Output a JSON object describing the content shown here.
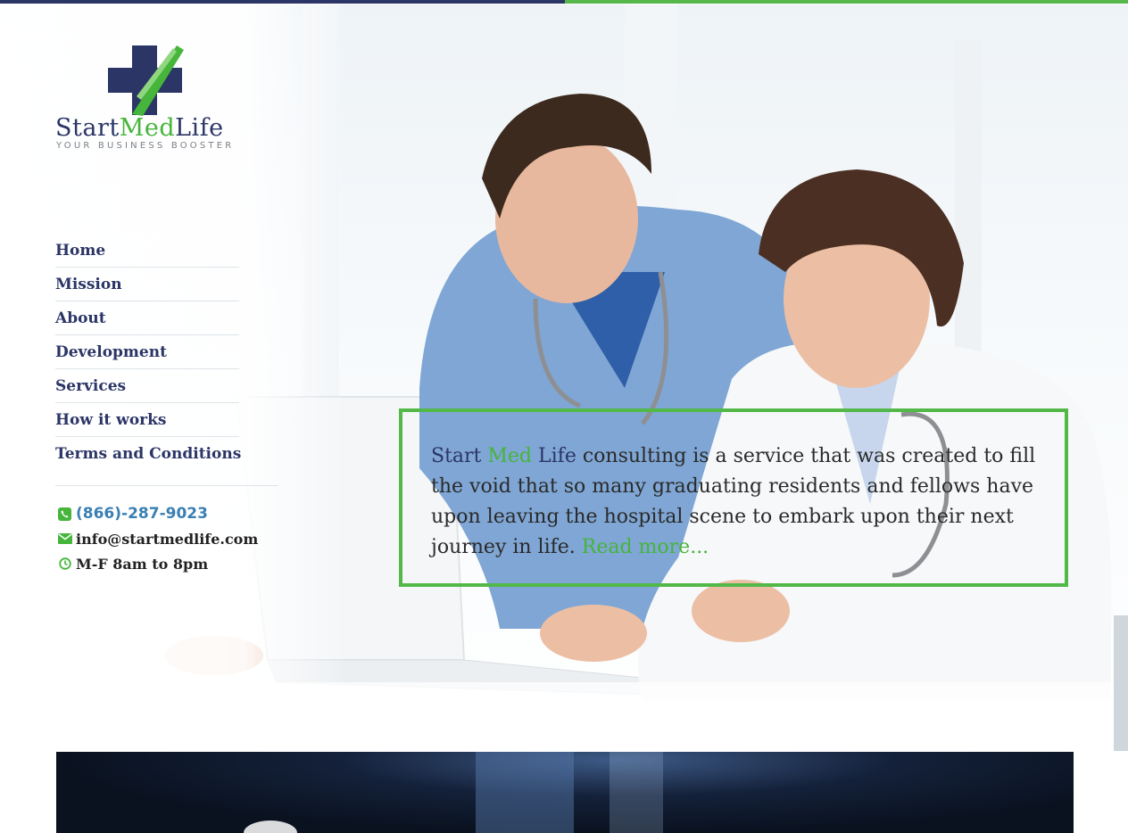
{
  "brand": {
    "name_start": "Start",
    "name_med": "Med",
    "name_life": "Life",
    "tagline": "YOUR BUSINESS BOOSTER",
    "colors": {
      "navy": "#2b3566",
      "green": "#46b53b",
      "phone_blue": "#3a7fb3"
    }
  },
  "nav": {
    "items": [
      {
        "label": "Home"
      },
      {
        "label": "Mission"
      },
      {
        "label": "About"
      },
      {
        "label": "Development"
      },
      {
        "label": "Services"
      },
      {
        "label": "How it works"
      },
      {
        "label": "Terms and Conditions"
      }
    ]
  },
  "contact": {
    "phone": "(866)-287-9023",
    "email": "info@startmedlife.com",
    "hours": "M-F 8am to 8pm",
    "icons": [
      "phone-icon",
      "envelope-icon",
      "clock-icon"
    ]
  },
  "callout": {
    "word_start": "Start",
    "word_med": "Med",
    "word_life": "Life",
    "body": " consulting is a service that was created to fill the void that so many graduating residents and fellows have upon leaving the hospital scene to embark upon their next journey in life. ",
    "read_more": "Read more..."
  }
}
